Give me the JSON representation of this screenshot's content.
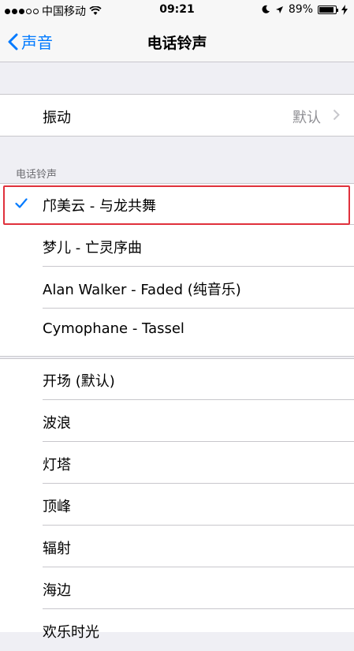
{
  "status_bar": {
    "carrier": "中国移动",
    "time": "09:21",
    "battery": "89%",
    "battery_level": 0.89
  },
  "nav": {
    "back_label": "声音",
    "title": "电话铃声"
  },
  "vibration": {
    "label": "振动",
    "value": "默认"
  },
  "section": {
    "header": "电话铃声"
  },
  "custom_ringtones": [
    {
      "label": "邝美云 - 与龙共舞",
      "selected": true
    },
    {
      "label": "梦儿 - 亡灵序曲",
      "selected": false
    },
    {
      "label": "Alan Walker - Faded (纯音乐)",
      "selected": false
    },
    {
      "label": "Cymophane - Tassel",
      "selected": false
    }
  ],
  "builtin_ringtones": [
    {
      "label": "开场 (默认)"
    },
    {
      "label": "波浪"
    },
    {
      "label": "灯塔"
    },
    {
      "label": "顶峰"
    },
    {
      "label": "辐射"
    },
    {
      "label": "海边"
    },
    {
      "label": "欢乐时光"
    }
  ],
  "colors": {
    "accent": "#007aff",
    "highlight_border": "#e0313c",
    "background": "#efeff4"
  },
  "icons": [
    "signal-dots-icon",
    "wifi-icon",
    "moon-icon",
    "location-arrow-icon",
    "battery-icon",
    "charging-icon",
    "back-chevron-icon",
    "chevron-right-icon",
    "checkmark-icon"
  ]
}
